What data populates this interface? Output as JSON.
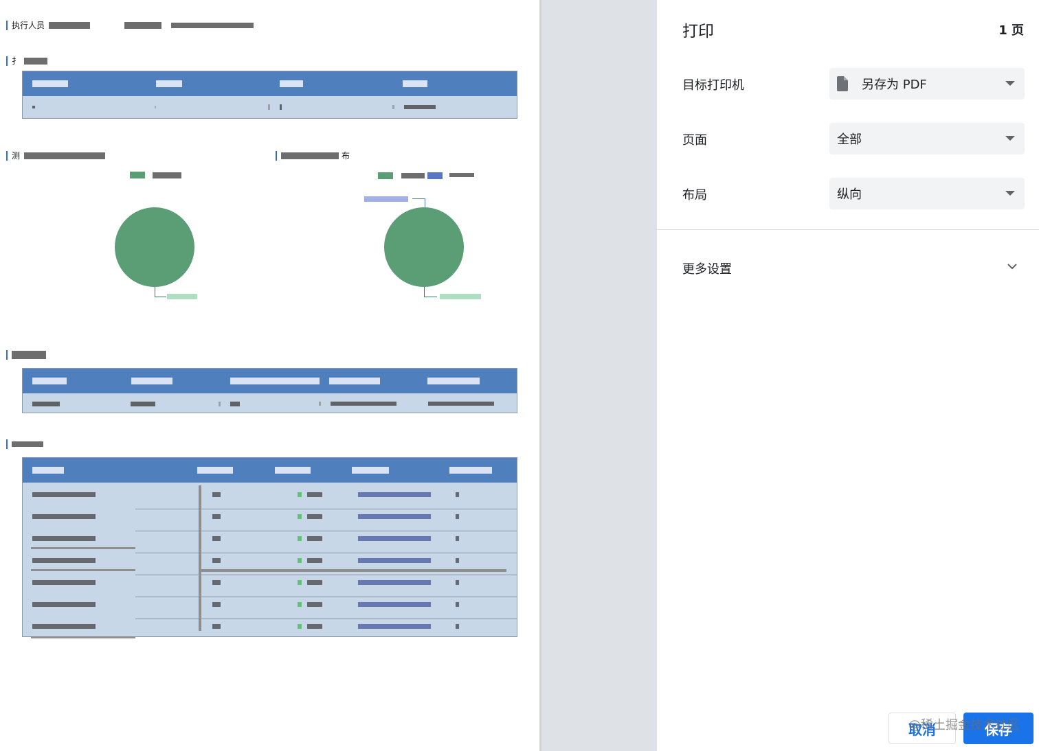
{
  "preview": {
    "header_label": "执行人员",
    "section_chart_right_tail": "布",
    "section_chart_left_head": "测",
    "section_top_head": "扌"
  },
  "print_panel": {
    "title": "打印",
    "page_count": "1 页",
    "destination_label": "目标打印机",
    "destination_value": "另存为 PDF",
    "pages_label": "页面",
    "pages_value": "全部",
    "layout_label": "布局",
    "layout_value": "纵向",
    "more_settings_label": "更多设置",
    "cancel_label": "取消",
    "save_label": "保存",
    "watermark": "@稀土掘金技术社区"
  },
  "colors": {
    "table_header": "#4f7fbd",
    "table_body": "#c8d7e8",
    "pie_green": "#5b9e75",
    "legend_blue": "#5876c8",
    "accent_blue": "#1a73e8"
  },
  "icons": [
    "file-icon",
    "caret-down-icon",
    "chevron-down-icon"
  ]
}
